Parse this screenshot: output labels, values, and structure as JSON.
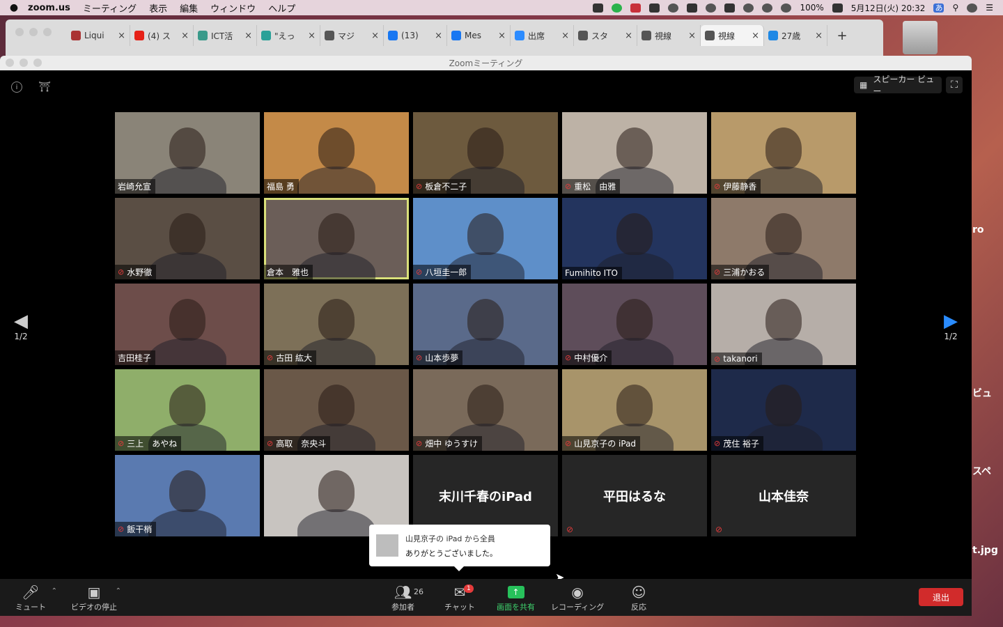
{
  "menubar": {
    "apple": "",
    "app": "zoom.us",
    "items": [
      "ミーティング",
      "表示",
      "編集",
      "ウィンドウ",
      "ヘルプ"
    ],
    "battery": "100%",
    "datetime": "5月12日(火) 20:32",
    "input_method": "あ"
  },
  "browser": {
    "tabs": [
      {
        "label": "Liqui",
        "icon": "page-icon",
        "color": "#aa3333"
      },
      {
        "label": "(4) ス",
        "icon": "youtube-icon",
        "color": "#e62117"
      },
      {
        "label": "ICT活",
        "icon": "page-icon",
        "color": "#3a9a8a"
      },
      {
        "label": "\"えっ",
        "icon": "page-icon",
        "color": "#2aa198"
      },
      {
        "label": "マジ",
        "icon": "globe-icon",
        "color": "#555555"
      },
      {
        "label": "(13)",
        "icon": "facebook-icon",
        "color": "#1877f2"
      },
      {
        "label": "Mes",
        "icon": "facebook-icon",
        "color": "#1877f2"
      },
      {
        "label": "出席",
        "icon": "zoom-icon",
        "color": "#2d8cff"
      },
      {
        "label": "スタ",
        "icon": "globe-icon",
        "color": "#555555"
      },
      {
        "label": "視線",
        "icon": "globe-icon",
        "color": "#555555"
      },
      {
        "label": "視線",
        "icon": "globe-icon",
        "color": "#555555",
        "active": true
      },
      {
        "label": "27歳",
        "icon": "pen-icon",
        "color": "#1e88e5"
      }
    ],
    "new_tab": "+"
  },
  "zoom": {
    "window_title": "Zoomミーティング",
    "speaker_view_label": "スピーカー ビュー",
    "page_indicator_left": "1/2",
    "page_indicator_right": "1/2",
    "participants": [
      {
        "name": "岩崎允宣",
        "muted": false,
        "video": true,
        "bg": "#8a8478"
      },
      {
        "name": "福島 勇",
        "muted": false,
        "video": true,
        "bg": "#c48a48"
      },
      {
        "name": "板倉不二子",
        "muted": true,
        "video": true,
        "bg": "#6d5a3e"
      },
      {
        "name": "重松　由雅",
        "muted": true,
        "video": true,
        "bg": "#bdb2a6"
      },
      {
        "name": "伊藤静香",
        "muted": true,
        "video": true,
        "bg": "#b89a6a"
      },
      {
        "name": "水野徹",
        "muted": true,
        "video": true,
        "bg": "#5a4e44"
      },
      {
        "name": "倉本　雅也",
        "muted": false,
        "video": true,
        "bg": "#6b5e58",
        "active": true
      },
      {
        "name": "八垣圭一郎",
        "muted": true,
        "video": true,
        "bg": "#5e8fc9"
      },
      {
        "name": "Fumihito ITO",
        "muted": false,
        "video": true,
        "bg": "#23345e"
      },
      {
        "name": "三浦かおる",
        "muted": true,
        "video": true,
        "bg": "#8e7a6a"
      },
      {
        "name": "吉田桂子",
        "muted": false,
        "video": true,
        "bg": "#6d4d4a"
      },
      {
        "name": "古田 紘大",
        "muted": true,
        "video": true,
        "bg": "#7d7058"
      },
      {
        "name": "山本歩夢",
        "muted": true,
        "video": true,
        "bg": "#5a6a8a"
      },
      {
        "name": "中村優介",
        "muted": true,
        "video": true,
        "bg": "#5e4d5a"
      },
      {
        "name": "takanori",
        "muted": true,
        "video": true,
        "bg": "#b6aea8"
      },
      {
        "name": "三上　あやね",
        "muted": true,
        "video": true,
        "bg": "#8fae6a"
      },
      {
        "name": "高取　奈央斗",
        "muted": true,
        "video": true,
        "bg": "#6a5848"
      },
      {
        "name": "畑中 ゆうすけ",
        "muted": true,
        "video": true,
        "bg": "#7a6a5a"
      },
      {
        "name": "山見京子の iPad",
        "muted": true,
        "video": true,
        "bg": "#a8946a"
      },
      {
        "name": "茂住 裕子",
        "muted": true,
        "video": true,
        "bg": "#1e2a4a"
      },
      {
        "name": "飯干梢",
        "muted": true,
        "video": true,
        "bg": "#5a7ab0"
      },
      {
        "name": "",
        "muted": false,
        "video": true,
        "bg": "#c8c4c0"
      },
      {
        "name": "末川千春のiPad",
        "muted": false,
        "video": false,
        "bg": "#262626"
      },
      {
        "name": "平田はるな",
        "muted": true,
        "video": false,
        "bg": "#262626"
      },
      {
        "name": "山本佳奈",
        "muted": true,
        "video": false,
        "bg": "#262626"
      }
    ],
    "chat_toast": {
      "sender": "山見京子の iPad から全員",
      "message": "ありがとうございました。"
    },
    "toolbar": {
      "mute": "ミュート",
      "video": "ビデオの停止",
      "participants": "参加者",
      "participants_count": "26",
      "chat": "チャット",
      "chat_badge": "1",
      "share": "画面を共有",
      "record": "レコーディング",
      "reactions": "反応",
      "leave": "退出"
    }
  },
  "desktop": {
    "labels": [
      "ro",
      "ビュ",
      "スペ",
      "t.jpg"
    ]
  }
}
